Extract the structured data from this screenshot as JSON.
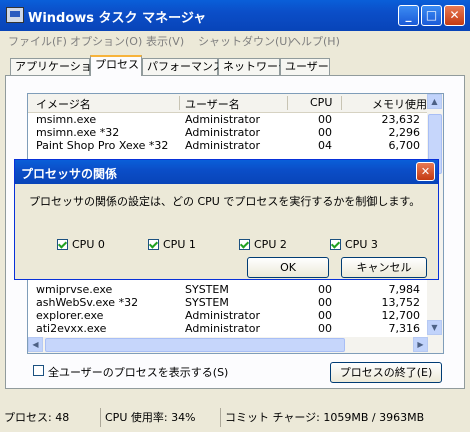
{
  "window": {
    "title": "Windows タスク マネージャ",
    "min_label": "_",
    "max_label": "□",
    "close_label": "✕"
  },
  "menu": [
    "ファイル(F)",
    "オプション(O)",
    "表示(V)",
    "シャットダウン(U)",
    "ヘルプ(H)"
  ],
  "tabs": [
    "アプリケーション",
    "プロセス",
    "パフォーマンス",
    "ネットワーク",
    "ユーザー"
  ],
  "process_list": {
    "headers": [
      "イメージ名",
      "ユーザー名",
      "CPU",
      "メモリ使用量"
    ],
    "rows": [
      [
        "msimn.exe",
        "Administrator",
        "00",
        "23,632"
      ],
      [
        "msimn.exe *32",
        "Administrator",
        "00",
        "2,296"
      ],
      [
        "Paint Shop Pro Xexe *32",
        "Administrator",
        "04",
        "6,700"
      ],
      [
        "wmiprvse.exe",
        "SYSTEM",
        "00",
        "7,984"
      ],
      [
        "ashWebSv.exe *32",
        "SYSTEM",
        "00",
        "13,752"
      ],
      [
        "explorer.exe",
        "Administrator",
        "00",
        "12,700"
      ],
      [
        "ati2evxx.exe",
        "Administrator",
        "00",
        "7,316"
      ]
    ]
  },
  "show_all_users_label": "全ユーザーのプロセスを表示する(S)",
  "end_process_label": "プロセスの終了(E)",
  "status": {
    "processes": "プロセス: 48",
    "cpu": "CPU 使用率: 34%",
    "commit": "コミット チャージ: 1059MB / 3963MB"
  },
  "dialog": {
    "title": "プロセッサの関係",
    "close_label": "✕",
    "description": "プロセッサの関係の設定は、どの CPU でプロセスを実行するかを制御します。",
    "cpus": [
      "CPU 0",
      "CPU 1",
      "CPU 2",
      "CPU 3"
    ],
    "ok_label": "OK",
    "cancel_label": "キャンセル"
  }
}
